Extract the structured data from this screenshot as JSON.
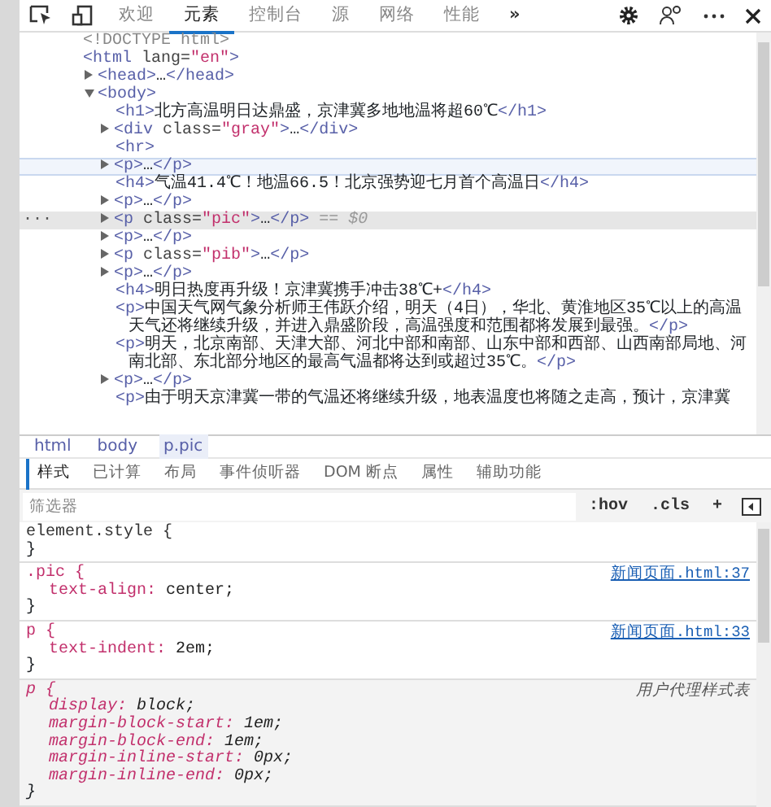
{
  "toolbar": {
    "tabs": [
      {
        "label": "欢迎",
        "selected": false
      },
      {
        "label": "元素",
        "selected": true
      },
      {
        "label": "控制台",
        "selected": false
      },
      {
        "label": "源",
        "selected": false
      },
      {
        "label": "网络",
        "selected": false
      },
      {
        "label": "性能",
        "selected": false
      }
    ],
    "overflow": "»"
  },
  "dom_tree": [
    {
      "kind": "doctype",
      "text": "<!DOCTYPE html>",
      "selected": false,
      "hovered": false
    },
    {
      "kind": "element",
      "text": "<html lang=\"en\">",
      "selected": false,
      "hovered": false,
      "children": [
        {
          "kind": "element",
          "text": "<head>…</head>",
          "expanded": false,
          "selected": false,
          "hovered": false
        },
        {
          "kind": "element",
          "text": "<body>",
          "expanded": true,
          "selected": false,
          "hovered": false,
          "children": [
            {
              "kind": "element",
              "text": "<h1>北方高温明日达鼎盛，京津冀多地地温将超60℃</h1>",
              "selected": false,
              "hovered": false
            },
            {
              "kind": "element",
              "text": "<div class=\"gray\">…</div>",
              "expanded": false,
              "selected": false,
              "hovered": false
            },
            {
              "kind": "element",
              "text": "<hr>",
              "selected": false,
              "hovered": false
            },
            {
              "kind": "element",
              "text": "<p>…</p>",
              "expanded": false,
              "selected": false,
              "hovered": true
            },
            {
              "kind": "element",
              "text": "<h4>气温41.4℃！地温66.5！北京强势迎七月首个高温日</h4>",
              "selected": false,
              "hovered": false
            },
            {
              "kind": "element",
              "text": "<p>…</p>",
              "expanded": false,
              "selected": false,
              "hovered": false
            },
            {
              "kind": "element",
              "text": "<p class=\"pic\">…</p>",
              "expanded": false,
              "selected": true,
              "hovered": false,
              "marker": "···",
              "suffix": "== $0"
            },
            {
              "kind": "element",
              "text": "<p>…</p>",
              "expanded": false,
              "selected": false,
              "hovered": false
            },
            {
              "kind": "element",
              "text": "<p class=\"pib\">…</p>",
              "expanded": false,
              "selected": false,
              "hovered": false
            },
            {
              "kind": "element",
              "text": "<p>…</p>",
              "expanded": false,
              "selected": false,
              "hovered": false
            },
            {
              "kind": "element",
              "text": "<h4>明日热度再升级！京津冀携手冲击38℃+</h4>",
              "selected": false,
              "hovered": false
            },
            {
              "kind": "element",
              "text": "<p>中国天气网气象分析师王伟跃介绍，明天（4日），华北、黄淮地区35℃以上的高温天气还将继续升级，并进入鼎盛阶段，高温强度和范围都将发展到最强。</p>",
              "selected": false,
              "hovered": false
            },
            {
              "kind": "element",
              "text": "<p>明天，北京南部、天津大部、河北中部和南部、山东中部和西部、山西南部局地、河南北部、东北部分地区的最高气温都将达到或超过35℃。</p>",
              "selected": false,
              "hovered": false
            },
            {
              "kind": "element",
              "text": "<p>…</p>",
              "expanded": false,
              "selected": false,
              "hovered": false
            },
            {
              "kind": "element",
              "text": "<p>由于明天京津冀一带的气温还将继续升级，地表温度也将随之走高，预计，京津冀",
              "selected": false,
              "hovered": false
            }
          ]
        }
      ]
    }
  ],
  "breadcrumbs": [
    {
      "label": "html",
      "selected": false
    },
    {
      "label": "body",
      "selected": false
    },
    {
      "label": "p.pic",
      "selected": true
    }
  ],
  "pane_tabs": [
    {
      "label": "样式",
      "selected": true
    },
    {
      "label": "已计算",
      "selected": false
    },
    {
      "label": "布局",
      "selected": false
    },
    {
      "label": "事件侦听器",
      "selected": false
    },
    {
      "label": "DOM 断点",
      "selected": false
    },
    {
      "label": "属性",
      "selected": false
    },
    {
      "label": "辅助功能",
      "selected": false
    }
  ],
  "filter": {
    "placeholder": "筛选器",
    "buttons": [
      ":hov",
      ".cls",
      "+"
    ]
  },
  "rules": [
    {
      "kind": "inline",
      "selector": "element.style {",
      "close": "}"
    },
    {
      "kind": "author",
      "selector": ".pic {",
      "source": "新闻页面.html:37",
      "declarations": [
        "text-align: center;"
      ],
      "close": "}"
    },
    {
      "kind": "author",
      "selector": "p {",
      "source": "新闻页面.html:33",
      "declarations": [
        "text-indent: 2em;"
      ],
      "close": "}"
    },
    {
      "kind": "user-agent",
      "selector": "p {",
      "source": "用户代理样式表",
      "declarations": [
        "display: block;",
        "margin-block-start: 1em;",
        "margin-block-end: 1em;",
        "margin-inline-start: 0px;",
        "margin-inline-end: 0px;"
      ],
      "close": "}"
    }
  ]
}
